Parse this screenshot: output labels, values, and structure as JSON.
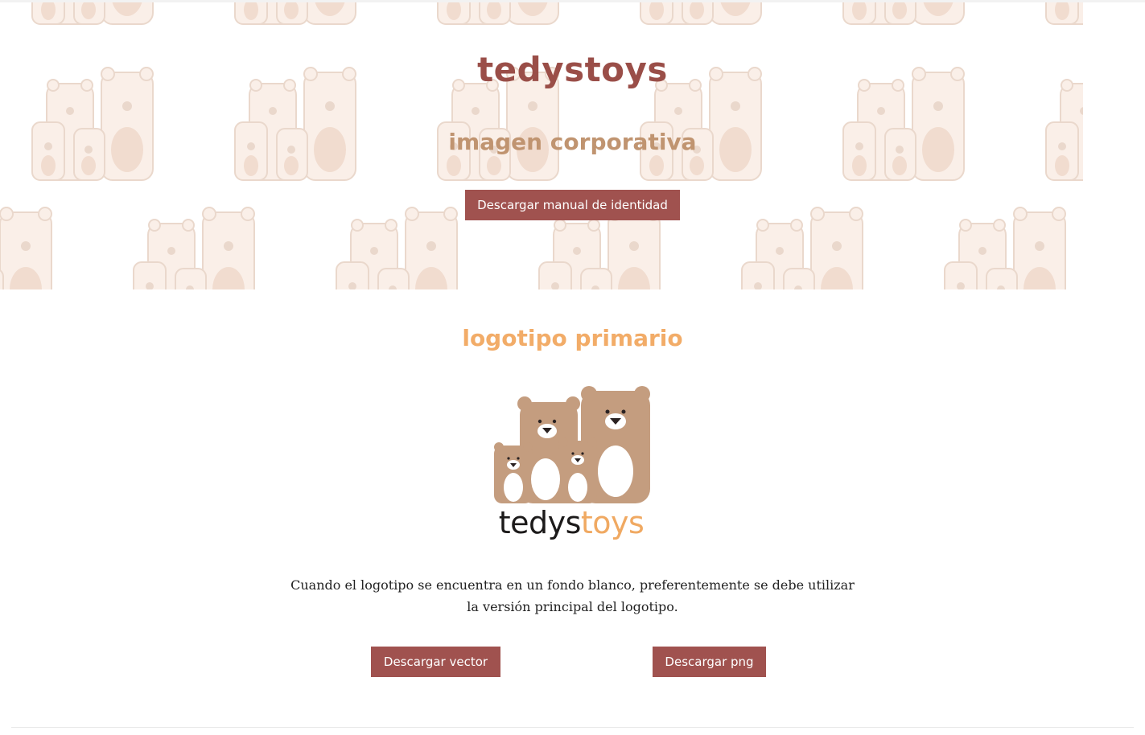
{
  "hero": {
    "brand_title": "tedystoys",
    "subtitle": "imagen corporativa",
    "download_manual_label": "Descargar manual de identidad",
    "pattern_icon": "bear-family-pattern"
  },
  "primary_logo": {
    "title": "logotipo primario",
    "logo_icon": "tedystoys-bear-family-logo",
    "wordmark_dark": "tedys",
    "wordmark_light": "toys",
    "description": "Cuando el logotipo se encuentra en un fondo blanco, preferentemente se debe utilizar la versión principal del logotipo.",
    "download_vector_label": "Descargar vector",
    "download_png_label": "Descargar png"
  },
  "colors": {
    "brand_red": "#9a4e48",
    "button_red": "#a0524f",
    "tan": "#c09470",
    "orange": "#f2ac68",
    "bear_brown": "#c49d7f",
    "pattern_fill": "#faefe8",
    "pattern_stroke": "#ead8cc"
  }
}
